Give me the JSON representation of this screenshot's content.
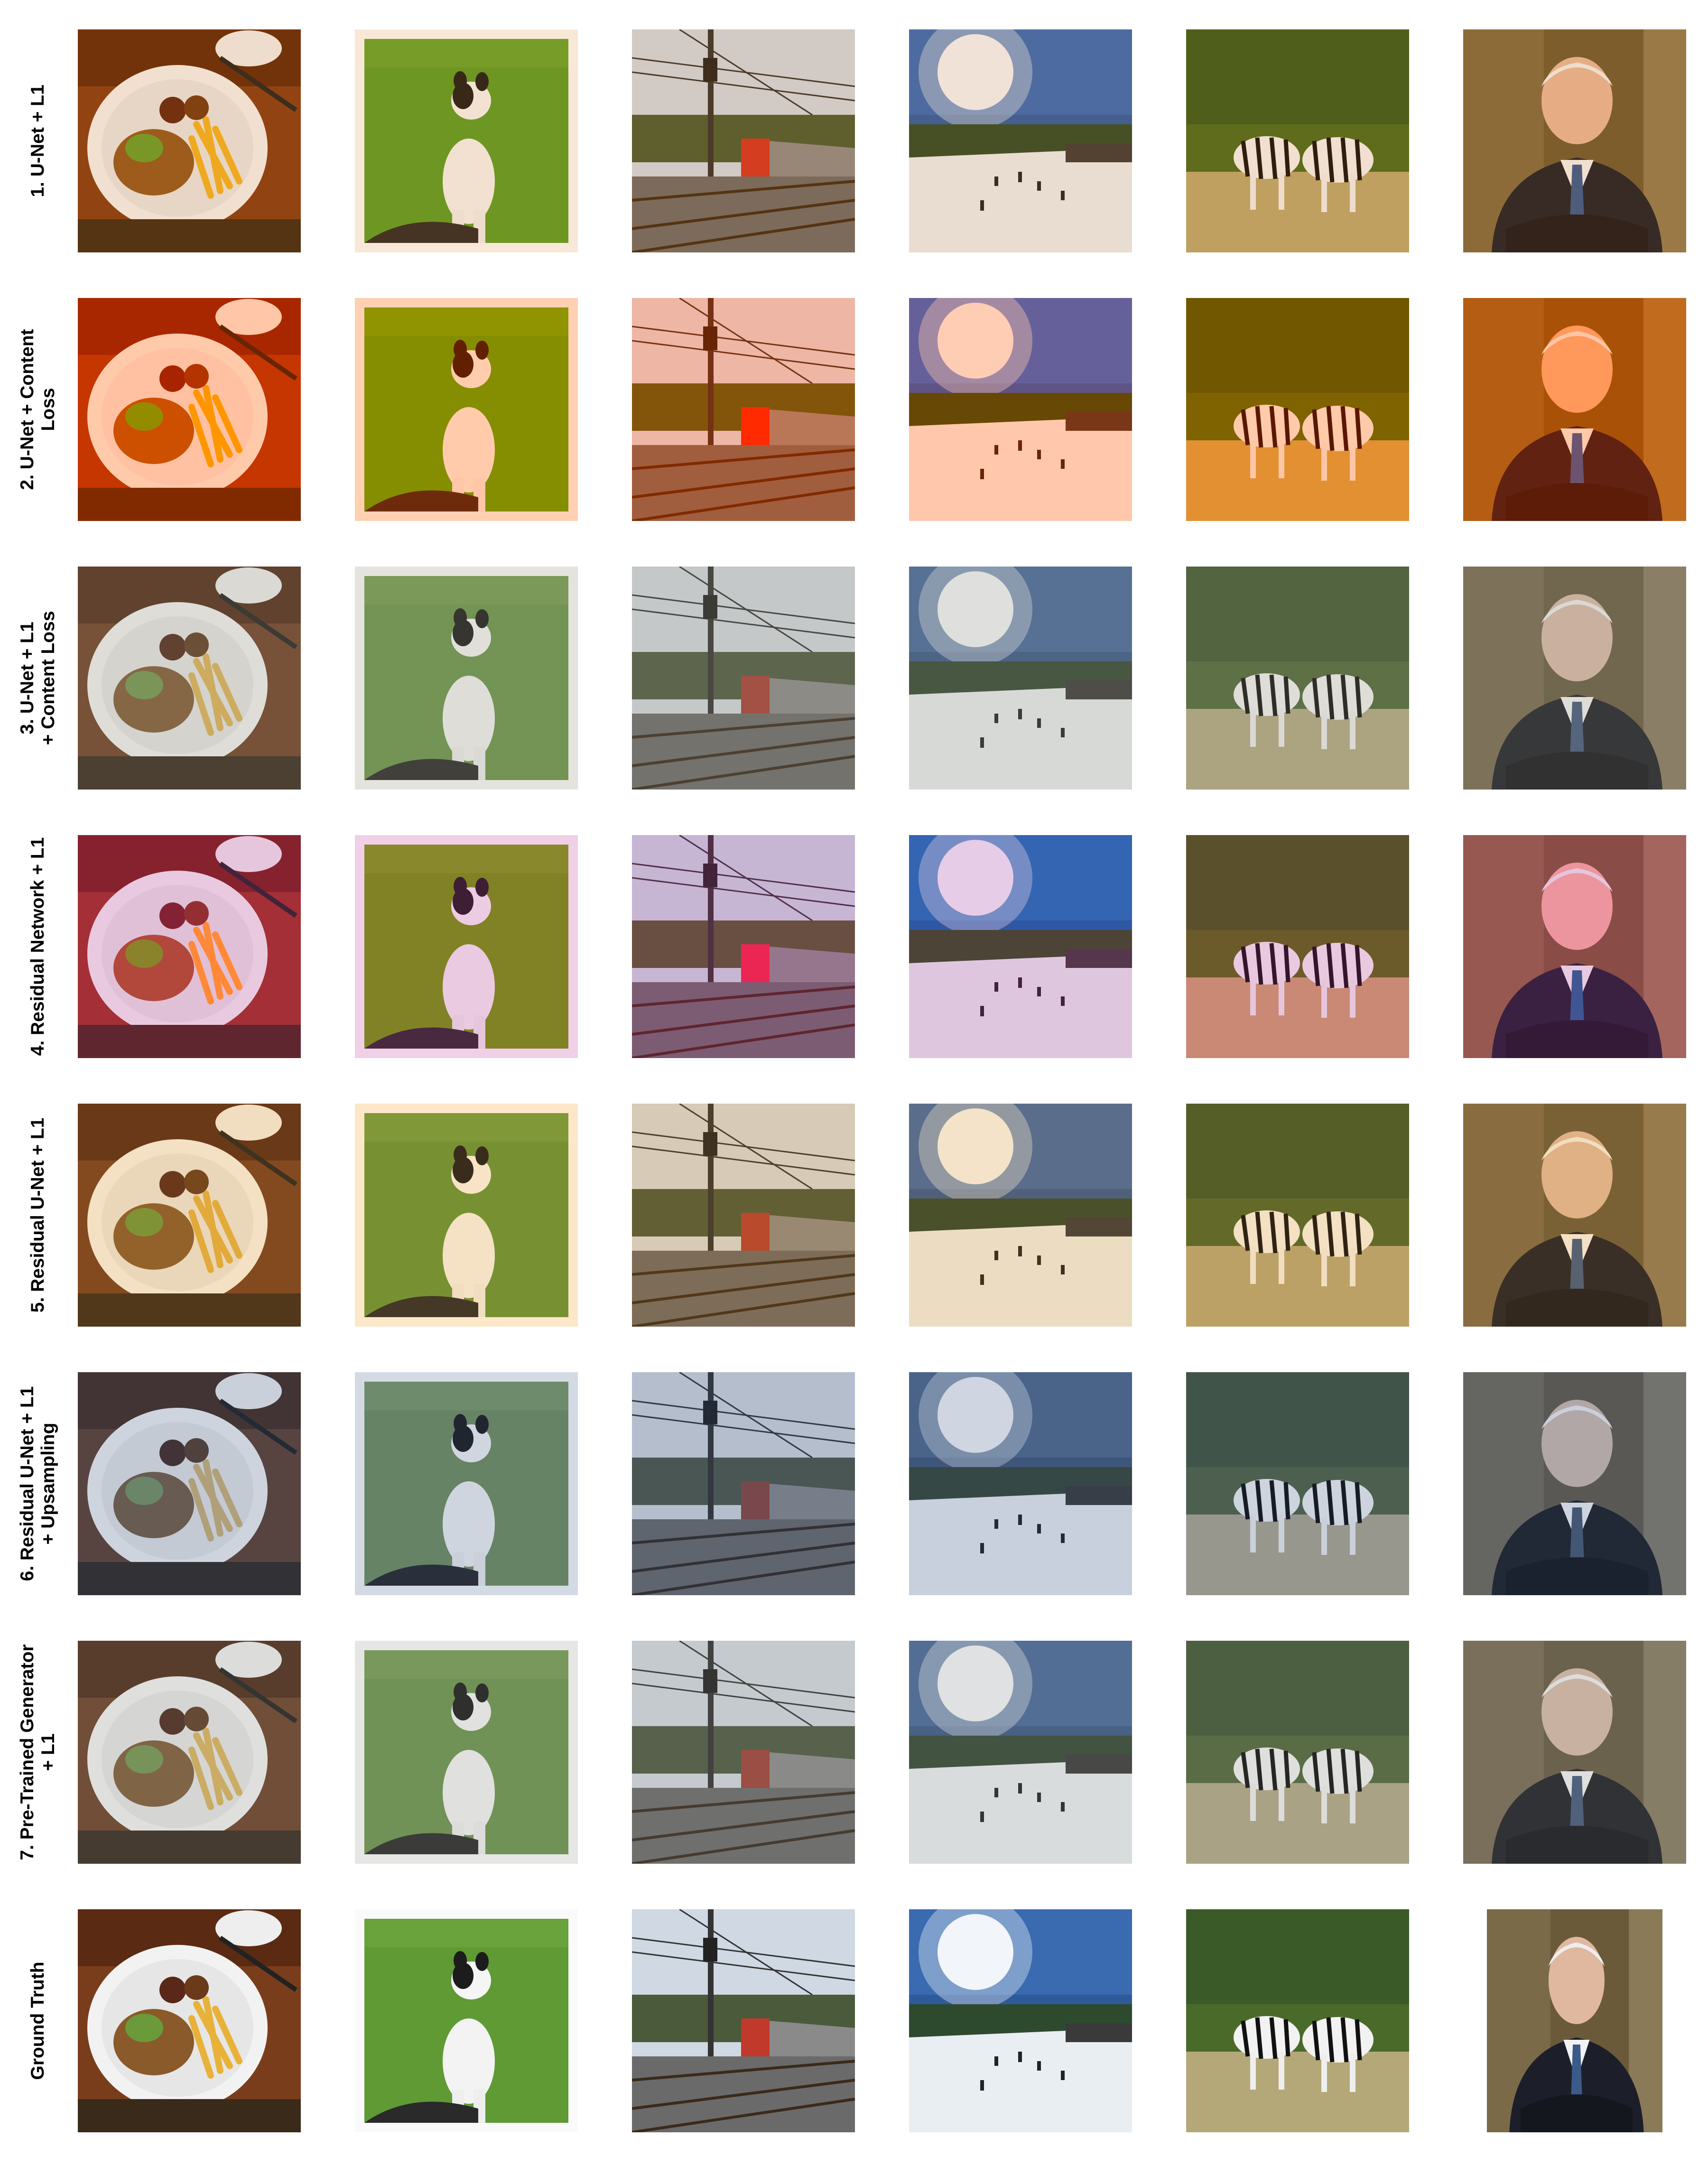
{
  "figure": {
    "columns": [
      "food",
      "dog",
      "train",
      "ski",
      "zebra",
      "portrait"
    ],
    "rows": [
      {
        "label_lines": [
          "1. U-Net + L1"
        ],
        "style": "warm"
      },
      {
        "label_lines": [
          "2. U-Net + Content",
          "Loss"
        ],
        "style": "vivid"
      },
      {
        "label_lines": [
          "3. U-Net + L1",
          "+ Content Loss"
        ],
        "style": "muted"
      },
      {
        "label_lines": [
          "4. Residual Network + L1"
        ],
        "style": "artifact"
      },
      {
        "label_lines": [
          "5. Residual U-Net + L1"
        ],
        "style": "sepia"
      },
      {
        "label_lines": [
          "6. Residual U-Net + L1",
          "+ Upsampling"
        ],
        "style": "bluish"
      },
      {
        "label_lines": [
          "7. Pre-Trained Generator",
          "+ L1"
        ],
        "style": "desat"
      },
      {
        "label_lines": [
          "Ground Truth"
        ],
        "style": "true"
      }
    ]
  }
}
